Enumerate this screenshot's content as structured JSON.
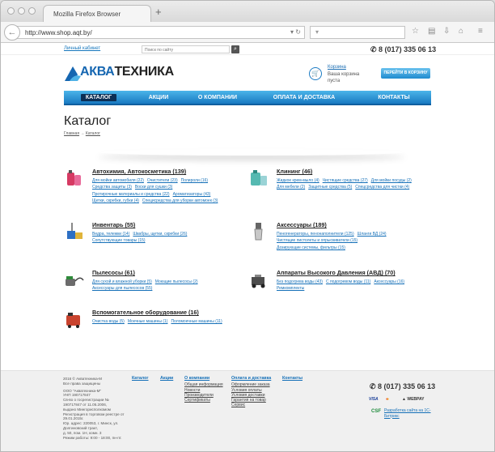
{
  "browser": {
    "tab_title": "Mozilla Firefox Browser",
    "new_tab": "+",
    "url": "http://www.shop.aqt.by/"
  },
  "header": {
    "account_link": "Личный кабинет",
    "search_placeholder": "Поиск по сайту",
    "phone": "8 (017) 335 06 13",
    "logo_akva": "АКВА",
    "logo_tehnika": "ТЕХНИКА",
    "cart_label": "Корзина",
    "cart_status": "Ваша корзина пуста",
    "cart_button": "ПЕРЕЙТИ В КОРЗИНУ"
  },
  "nav": [
    "КАТАЛОГ",
    "АКЦИИ",
    "О КОМПАНИИ",
    "ОПЛАТА И ДОСТАВКА",
    "КОНТАКТЫ"
  ],
  "page": {
    "title": "Каталог",
    "crumb_home": "Главная",
    "crumb_arrow": "→",
    "crumb_current": "Каталог"
  },
  "categories": [
    {
      "title": "Автохимия, Автокосметика (139)",
      "links": [
        "Для мойки автомобиля (22)",
        "Очистители (23)",
        "Полироли (16)",
        "Средства защиты (3)",
        "Воски для сушки (3)",
        "Протирочные материалы и средства (22)",
        "Ароматизаторы (43)",
        "Щетки, скребки, губки (4)",
        "Специсредства для уборки автомоек (3)"
      ]
    },
    {
      "title": "Клининг (46)",
      "links": [
        "Жидкое крем-мыло (4)",
        "Чистящие средства (27)",
        "Для мойки посуды (2)",
        "Для мебели (2)",
        "Защитные средства (5)",
        "Спецсредства для чистки (4)"
      ]
    },
    {
      "title": "Инвентарь (55)",
      "links": [
        "Ведра, тележки (14)",
        "Швабры, щетки, скребки (26)",
        "Сопутствующие товары (15)"
      ]
    },
    {
      "title": "Аксессуары (189)",
      "links": [
        "Пеногенераторы, пенонаполнители (125)",
        "Шланги ВД (24)",
        "Чистящие пистолеты и опрыскиватели (15)",
        "Дозирующие системы, фильтры (15)"
      ]
    },
    {
      "title": "Пылесосы (61)",
      "links": [
        "Для сухой и влажной уборки (5)",
        "Моющие пылесосы (2)",
        "Аксессуары для пылесосов (55)"
      ]
    },
    {
      "title": "Аппараты Высокого Давления (АВД) (70)",
      "links": [
        "Без подогрева воды (43)",
        "С подогревом воды (11)",
        "Аксессуары (16)",
        "Ремкомплекты"
      ]
    },
    {
      "title": "Вспомогательное оборудование (16)",
      "links": [
        "Очистка воды (5)",
        "Моечные машины (1)",
        "Поломоечные машины (11)"
      ]
    }
  ],
  "footer": {
    "legal": [
      "2016 © Акватехника-М",
      "Все права защищены",
      "",
      "ООО \"Акватехника-М\"",
      "УНП 190717847",
      "Св-во о госрегистрации № 190717847 от 11.05.2006,",
      "выдано Мингорисполкомом",
      "Регистрация в торговом реестре от 29.01.2015г.",
      "Юр. адрес: 220053, г. Минск, ул. Долгиновский тракт,",
      "д. 50, пом. 1Н, комн. 3",
      "Режим работы: 9:00 - 18:00, пн-пт."
    ],
    "col_catalog": "Каталог",
    "col_akcii": "Акции",
    "col_company": {
      "title": "О компании",
      "items": [
        "Общая информация",
        "Новости",
        "Производители",
        "Сертификаты"
      ]
    },
    "col_delivery": {
      "title": "Оплата и доставка",
      "items": [
        "Оформление заказа",
        "Условия оплаты",
        "Условия доставки",
        "Гарантия на товар",
        "Сервис"
      ]
    },
    "col_contacts": "Контакты",
    "phone": "8 (017) 335 06 13",
    "visa": "VISA",
    "webpay": "WEBPAY",
    "csf": "CSF",
    "dev_link": "Разработка сайта на 1С-Битрикс"
  }
}
